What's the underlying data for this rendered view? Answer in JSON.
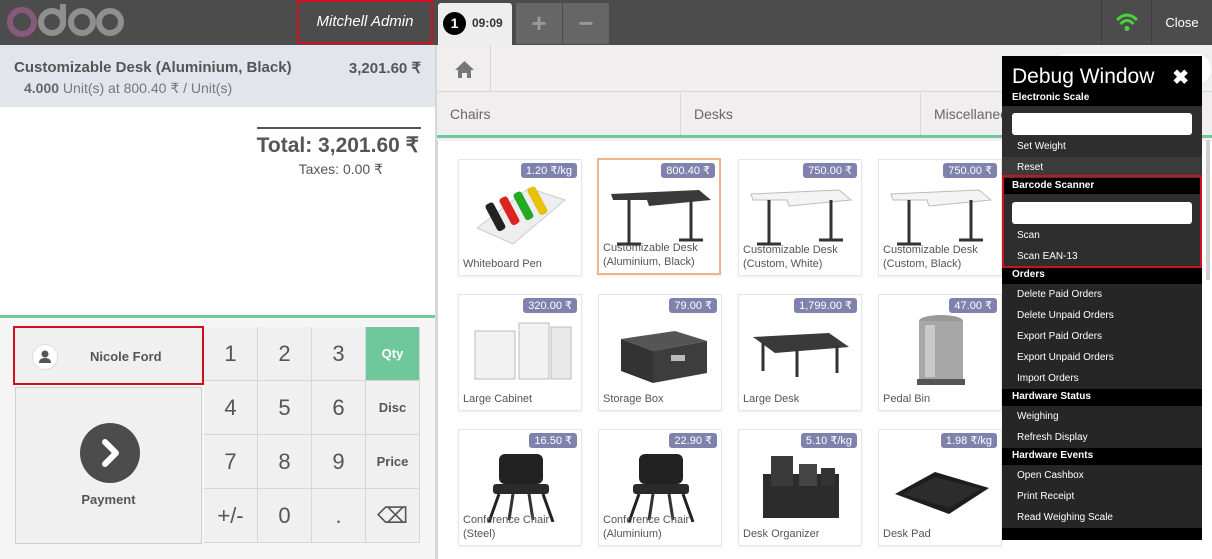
{
  "header": {
    "cashier": "Mitchell Admin",
    "order_number": "1",
    "order_time": "09:09",
    "add_order": "+",
    "remove_order": "−",
    "close_label": "Close"
  },
  "order": {
    "line": {
      "name": "Customizable Desk (Aluminium, Black)",
      "price": "3,201.60 ₹",
      "qty": "4.000",
      "detail": " Unit(s) at 800.40 ₹ / Unit(s)"
    },
    "total": "Total: 3,201.60 ₹",
    "taxes": "Taxes: 0.00 ₹"
  },
  "actionpad": {
    "customer": "Nicole Ford",
    "payment": "Payment"
  },
  "numpad": {
    "keys": [
      "1",
      "2",
      "3",
      "4",
      "5",
      "6",
      "7",
      "8",
      "9",
      "+/-",
      "0",
      "."
    ],
    "qty": "Qty",
    "disc": "Disc",
    "price": "Price",
    "backspace": "⌫"
  },
  "categories": [
    "Chairs",
    "Desks",
    "Miscellaneous"
  ],
  "products": [
    {
      "name": "Whiteboard Pen",
      "price": "1.20 ₹/kg"
    },
    {
      "name": "Customizable Desk (Aluminium, Black)",
      "price": "800.40 ₹"
    },
    {
      "name": "Customizable Desk (Custom, White)",
      "price": "750.00 ₹"
    },
    {
      "name": "Customizable Desk (Custom, Black)",
      "price": "750.00 ₹"
    },
    {
      "name": "Large Cabinet",
      "price": "320.00 ₹"
    },
    {
      "name": "Storage Box",
      "price": "79.00 ₹"
    },
    {
      "name": "Large Desk",
      "price": "1,799.00 ₹"
    },
    {
      "name": "Pedal Bin",
      "price": "47.00 ₹"
    },
    {
      "name": "Conference Chair (Steel)",
      "price": "16.50 ₹"
    },
    {
      "name": "Conference Chair (Aluminium)",
      "price": "22.90 ₹"
    },
    {
      "name": "Desk Organizer",
      "price": "5.10 ₹/kg"
    },
    {
      "name": "Desk Pad",
      "price": "1.98 ₹/kg"
    }
  ],
  "debug": {
    "title": "Debug Window",
    "close": "✖",
    "electronic_scale": "Electronic Scale",
    "set_weight": "Set Weight",
    "reset": "Reset",
    "barcode_scanner": "Barcode Scanner",
    "scan": "Scan",
    "scan_ean13": "Scan EAN-13",
    "orders": "Orders",
    "delete_paid": "Delete Paid Orders",
    "delete_unpaid": "Delete Unpaid Orders",
    "export_paid": "Export Paid Orders",
    "export_unpaid": "Export Unpaid Orders",
    "import_orders": "Import Orders",
    "hardware_status": "Hardware Status",
    "weighing": "Weighing",
    "refresh_display": "Refresh Display",
    "hardware_events": "Hardware Events",
    "open_cashbox": "Open Cashbox",
    "print_receipt": "Print Receipt",
    "read_weighing": "Read Weighing Scale"
  },
  "colors": {
    "accent_green": "#6ec89b",
    "topbar": "#4c4c4c",
    "price_tag": "#7f82ac",
    "highlight": "#d01020"
  }
}
